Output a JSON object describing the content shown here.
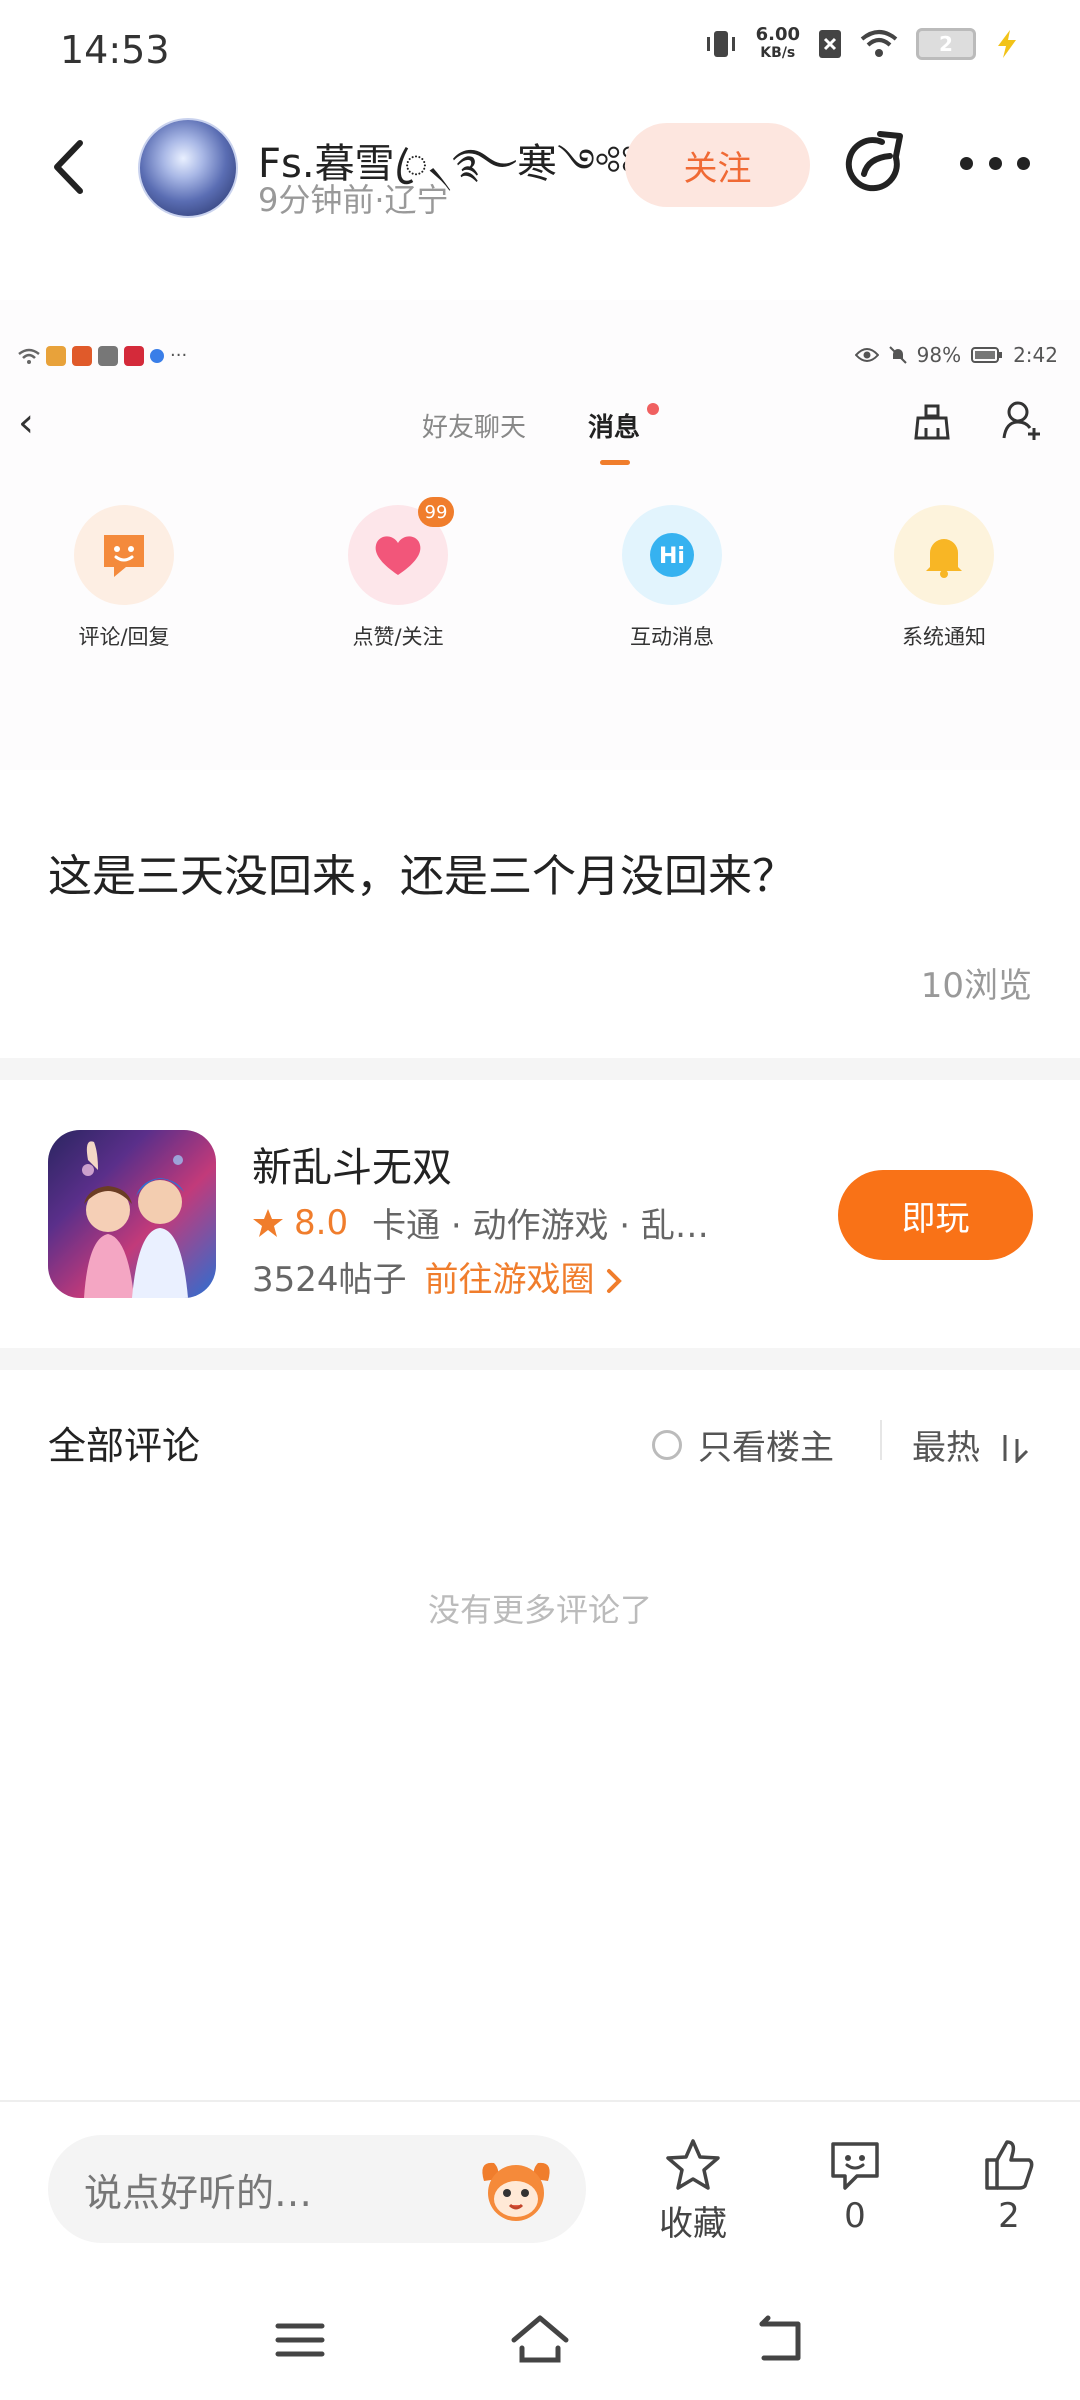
{
  "status_bar": {
    "time": "14:53",
    "speed_value": "6.00",
    "speed_unit": "KB/s",
    "battery_text": "2"
  },
  "header": {
    "author_name": "Fs.暮雪ꦿ৲࿐寒༺༻",
    "author_meta": "9分钟前·辽宁",
    "follow_label": "关注"
  },
  "screenshot": {
    "status_right": "98%",
    "time": "2:42",
    "tab_friends": "好友聊天",
    "tab_messages": "消息",
    "categories": [
      {
        "label": "评论/回复",
        "icon": "smile-chat-icon",
        "color": "#f48a3c",
        "bg": "#fdeee3"
      },
      {
        "label": "点赞/关注",
        "icon": "heart-icon",
        "color": "#f2567a",
        "bg": "#fde6ea",
        "badge": "99"
      },
      {
        "label": "互动消息",
        "icon": "hi-icon",
        "color": "#36b2f0",
        "bg": "#e2f4fd"
      },
      {
        "label": "系统通知",
        "icon": "bell-icon",
        "color": "#f8b625",
        "bg": "#fdf3dc"
      }
    ]
  },
  "post": {
    "text": "这是三天没回来，还是三个月没回来？",
    "views": "10浏览"
  },
  "game": {
    "name": "新乱斗无双",
    "rating": "8.0",
    "tags": "卡通 · 动作游戏 · 乱…",
    "posts": "3524帖子",
    "link": "前往游戏圈",
    "play_label": "即玩"
  },
  "comments": {
    "title": "全部评论",
    "op_only": "只看楼主",
    "sort": "最热",
    "empty": "没有更多评论了"
  },
  "bottom_bar": {
    "placeholder": "说点好听的…",
    "favorite_label": "收藏",
    "comment_count": "0",
    "like_count": "2"
  },
  "colors": {
    "accent": "#f97217",
    "follow_bg": "#fde6df"
  }
}
